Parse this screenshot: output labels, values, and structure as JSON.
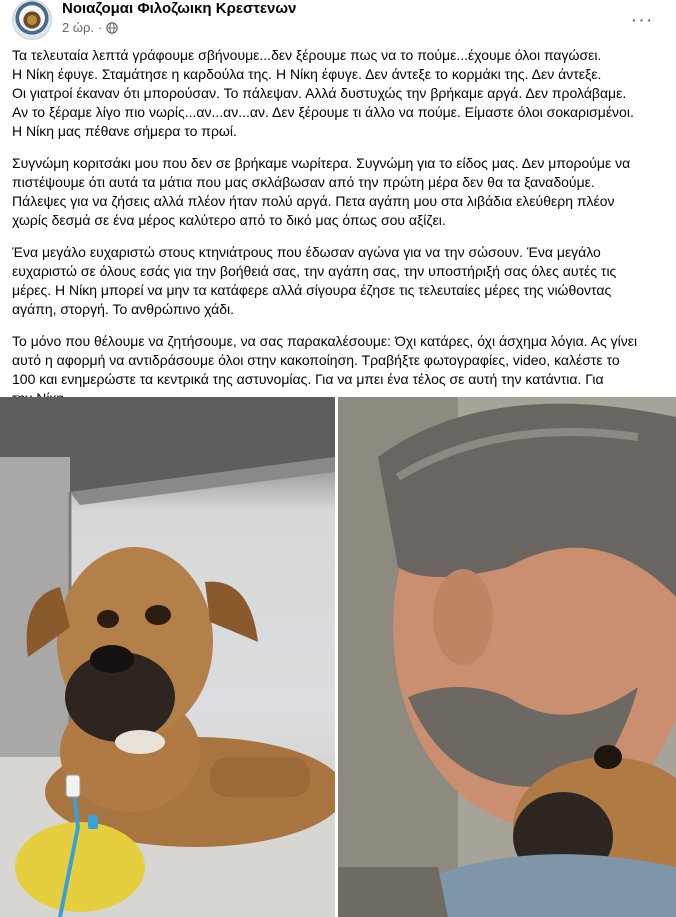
{
  "post": {
    "page_name": "Νοιαζομαι Φιλοζωικη Κρεστενων",
    "time": "2 ώρ.",
    "dot": "·",
    "more": "···",
    "paragraphs": [
      "Τα τελευταία λεπτά γράφουμε σβήνουμε...δεν ξέρουμε πως να το πούμε...έχουμε όλοι παγώσει.\nΗ Νίκη έφυγε.  Σταμάτησε η καρδούλα της.  Η Νίκη έφυγε.  Δεν άντεξε το κορμάκι της.  Δεν άντεξε.\nΟι γιατροί έκαναν ότι μπορούσαν.  Το πάλεψαν.  Αλλά δυστυχώς την βρήκαμε αργά.  Δεν προλάβαμε.\nΑν το ξέραμε λίγο πιο νωρίς...αν...αν...αν.  Δεν ξέρουμε τι άλλο να πούμε.  Είμαστε όλοι σοκαρισμένοι.\nΗ Νίκη μας πέθανε σήμερα το πρωί.",
      "Συγνώμη κοριτσάκι μου που δεν σε βρήκαμε νωρίτερα. Συγνώμη για το είδος μας. Δεν μπορούμε να\nπιστέψουμε ότι αυτά τα μάτια που μας σκλάβωσαν από την πρώτη μέρα δεν θα τα ξαναδούμε.\nΠάλεψες για να ζήσεις αλλά πλέον ήταν πολύ αργά. Πετα αγάπη μου στα λιβάδια ελεύθερη πλέον\nχωρίς δεσμά σε ένα μέρος καλύτερο από το δικό μας όπως σου αξίζει.",
      "Ένα μεγάλο ευχαριστώ στους κτηνιάτρους που έδωσαν αγώνα για να την σώσουν.  Ένα μεγάλο\nευχαριστώ σε όλους εσάς για την βοήθειά σας, την αγάπη σας, την υποστήριξή σας όλες αυτές τις\nμέρες.  Η Νίκη μπορεί να μην τα κατάφερε αλλά σίγουρα έζησε τις τελευταίες μέρες της νιώθοντας\nαγάπη, στοργή.  Το ανθρώπινο χάδι.",
      "Το μόνο που θέλουμε να ζητήσουμε, να σας παρακαλέσουμε: Όχι κατάρες, όχι άσχημα λόγια.  Ας γίνει\nαυτό η αφορμή να αντιδράσουμε όλοι στην κακοποίηση.  Τραβήξτε φωτογραφίες, video, καλέστε το\n100 και ενημερώστε τα κεντρικά της αστυνομίας.  Για να μπει ένα τέλος σε αυτή την κατάντια.  Για\nτην Νίκη."
    ]
  },
  "colors": {
    "text": "#050505",
    "secondary_text": "#65676b",
    "dog_fur": "#b07a45",
    "bandage": "#e6cf3e",
    "iv_line": "#3aa0d8"
  }
}
